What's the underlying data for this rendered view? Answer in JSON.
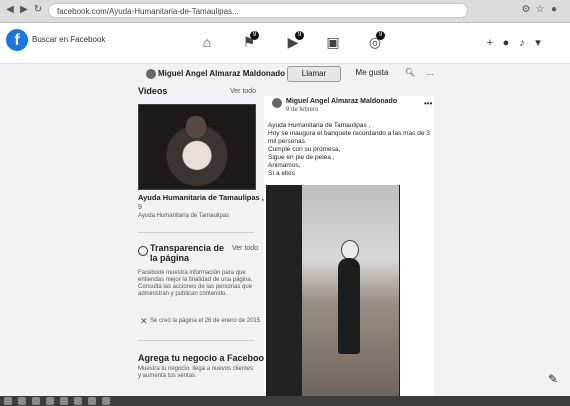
{
  "browser": {
    "url": "facebook.com/Ayuda-Humanitaria-de-Tamaulipas...",
    "nav": [
      "back",
      "forward",
      "reload"
    ]
  },
  "fb": {
    "search_placeholder": "Buscar en Facebook",
    "nav_badges": [
      "9",
      "9",
      "9"
    ]
  },
  "page": {
    "name": "Miguel Angel Almaraz Maldonado",
    "buttons": {
      "cover": "Llamar",
      "like": "Me gusta",
      "search": "search",
      "more": "..."
    }
  },
  "videos": {
    "title": "Videos",
    "see_all": "Ver todo",
    "video_title": "Ayuda Humanitaria de Tamaulipas , Reli...",
    "reactions": "9",
    "meta": "Ayuda Humanitaria de Tamaulipas"
  },
  "transparency": {
    "title": "Transparencia de la página",
    "see_all": "Ver todo",
    "description": "Facebook muestra información para que entiendas mejor la finalidad de una página. Consulta las acciones de las personas que administran y publican contenido.",
    "created": "Se creó la página el 26 de enero de 2015"
  },
  "promo": {
    "title": "Agrega tu negocio a Facebook",
    "text": "Muestra tu negocio, llega a nuevos clientes y aumenta tus ventas."
  },
  "post": {
    "author": "Miguel Angel Almaraz Maldonado",
    "date": "9 de febrero",
    "lines": [
      "Ayuda Humanitaria de Tamaulipas ,",
      "Hoy se inaugura el banquete recordando a las mas de 3 mil personas.",
      "Cumple con su promesa,",
      "Sigue en pie de pelea ,",
      "Animamos,",
      "Sí a ellos"
    ]
  },
  "taskbar": {
    "icons": [
      "start",
      "search",
      "taskview",
      "explorer",
      "edge",
      "chrome",
      "mail",
      "store"
    ]
  }
}
